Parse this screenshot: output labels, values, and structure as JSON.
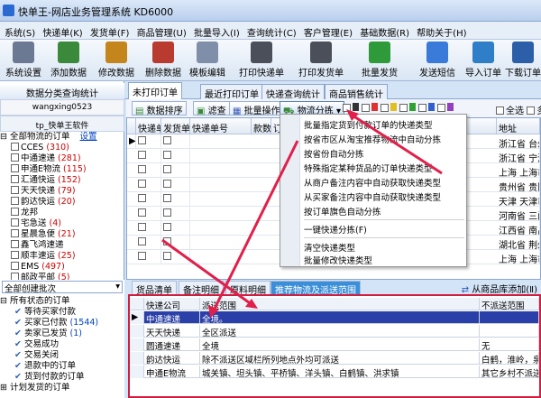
{
  "window": {
    "title": "快单王-网店业务管理系统 KD6000"
  },
  "menu": [
    "系统(S)",
    "快递单(K)",
    "发货单(F)",
    "商品管理(U)",
    "批量导入(I)",
    "查询统计(C)",
    "客户管理(E)",
    "基础数据(R)",
    "帮助关于(H)"
  ],
  "toolbar": [
    "系统设置",
    "添加数据",
    "修改数据",
    "删除数据",
    "模板编辑",
    "打印快递单",
    "打印发货单",
    "批量发货",
    "发送短信",
    "导入订单",
    "下载订单"
  ],
  "left": {
    "header": "数据分类查询统计",
    "user": "wangxing0523",
    "shop": "tp_快单王软件",
    "root": "全部物流的订单",
    "setting": "设置",
    "couriers": [
      {
        "name": "CCES",
        "count": "(310)"
      },
      {
        "name": "中通速递",
        "count": "(281)"
      },
      {
        "name": "申通E物流",
        "count": "(115)"
      },
      {
        "name": "汇通快运",
        "count": "(152)"
      },
      {
        "name": "天天快递",
        "count": "(79)"
      },
      {
        "name": "韵达快运",
        "count": "(20)"
      },
      {
        "name": "龙邦",
        "count": ""
      },
      {
        "name": "宅急送",
        "count": "(4)"
      },
      {
        "name": "星晨急便",
        "count": "(21)"
      },
      {
        "name": "鑫飞鸿速递",
        "count": ""
      },
      {
        "name": "顺丰速运",
        "count": "(25)"
      },
      {
        "name": "EMS",
        "count": "(497)"
      },
      {
        "name": "邮政平邮",
        "count": "(5)"
      }
    ],
    "batch_select": "全部创建批次",
    "status_root": "所有状态的订单",
    "statuses": [
      {
        "label": "等待买家付款",
        "count": ""
      },
      {
        "label": "买家已付款",
        "count": "(1544)"
      },
      {
        "label": "卖家已发货",
        "count": "(1)"
      },
      {
        "label": "交易成功",
        "count": ""
      },
      {
        "label": "交易关闭",
        "count": ""
      },
      {
        "label": "退款中的订单",
        "count": ""
      },
      {
        "label": "货到付款的订单",
        "count": ""
      }
    ],
    "planned": "计划发货的订单"
  },
  "tabs": [
    "未打印订单",
    "最近打印订单",
    "快递查询统计",
    "商品销售统计"
  ],
  "grid_tools": {
    "sort": "数据排序",
    "filter": "滤查",
    "batch": "批量操作",
    "logistics": "物流分拣",
    "select_all": "全选",
    "more": "多"
  },
  "grid": {
    "headers": [
      "快递单",
      "发货单",
      "快递单号",
      "款数",
      "订",
      "地址"
    ],
    "rows": [
      {
        "addr": "浙江省 台州"
      },
      {
        "addr": "浙江省 宁波"
      },
      {
        "addr": "上海 上海市"
      },
      {
        "addr": "贵州省 贵阳"
      },
      {
        "addr": "天津 天津市"
      },
      {
        "addr": "河南省 三门"
      },
      {
        "addr": "江西省 南昌"
      },
      {
        "addr": "湖北省 荆州"
      },
      {
        "addr": "上海 上海市"
      }
    ]
  },
  "context_menu": {
    "group1": [
      "批量指定货到付款订单的快递类型",
      "按省市区从淘宝推荐物流中自动分拣",
      "按省份自动分拣",
      "特殊指定某种货品的订单快递类型",
      "从商户备注内容中自动获取快递类型",
      "从买家备注内容中自动获取快递类型",
      "按订单旗色自动分拣"
    ],
    "group2": [
      "一键快递分拣(F)"
    ],
    "group3": [
      "清空快递类型",
      "批量修改快递类型"
    ]
  },
  "bottom_tabs": [
    "货品清单",
    "备注明细",
    "原料明细",
    "推荐物流及派送范围"
  ],
  "bottom_tool": "从商品库添加(Ⅱ)",
  "bottom_table": {
    "headers": [
      "快递公司",
      "派送范围",
      "不派送范围"
    ],
    "rows": [
      {
        "company": "中通速递",
        "range": "全境。",
        "exclude": ""
      },
      {
        "company": "天天快递",
        "range": "全区派送",
        "exclude": ""
      },
      {
        "company": "圆通速递",
        "range": "全境",
        "exclude": "无"
      },
      {
        "company": "韵达快运",
        "range": "除不派送区域栏所列地点外均可派送",
        "exclude": "白鹤，淮岭，泉子"
      },
      {
        "company": "申通E物流",
        "range": "城关镇、坦头镇、平桥镇、洋头镇、白鹤镇、洪求镇",
        "exclude": "其它乡村不派送"
      }
    ]
  },
  "colors": {
    "accent": "#3a8fd8",
    "arrow": "#e0204a",
    "highlight": "#2a3fa8"
  }
}
